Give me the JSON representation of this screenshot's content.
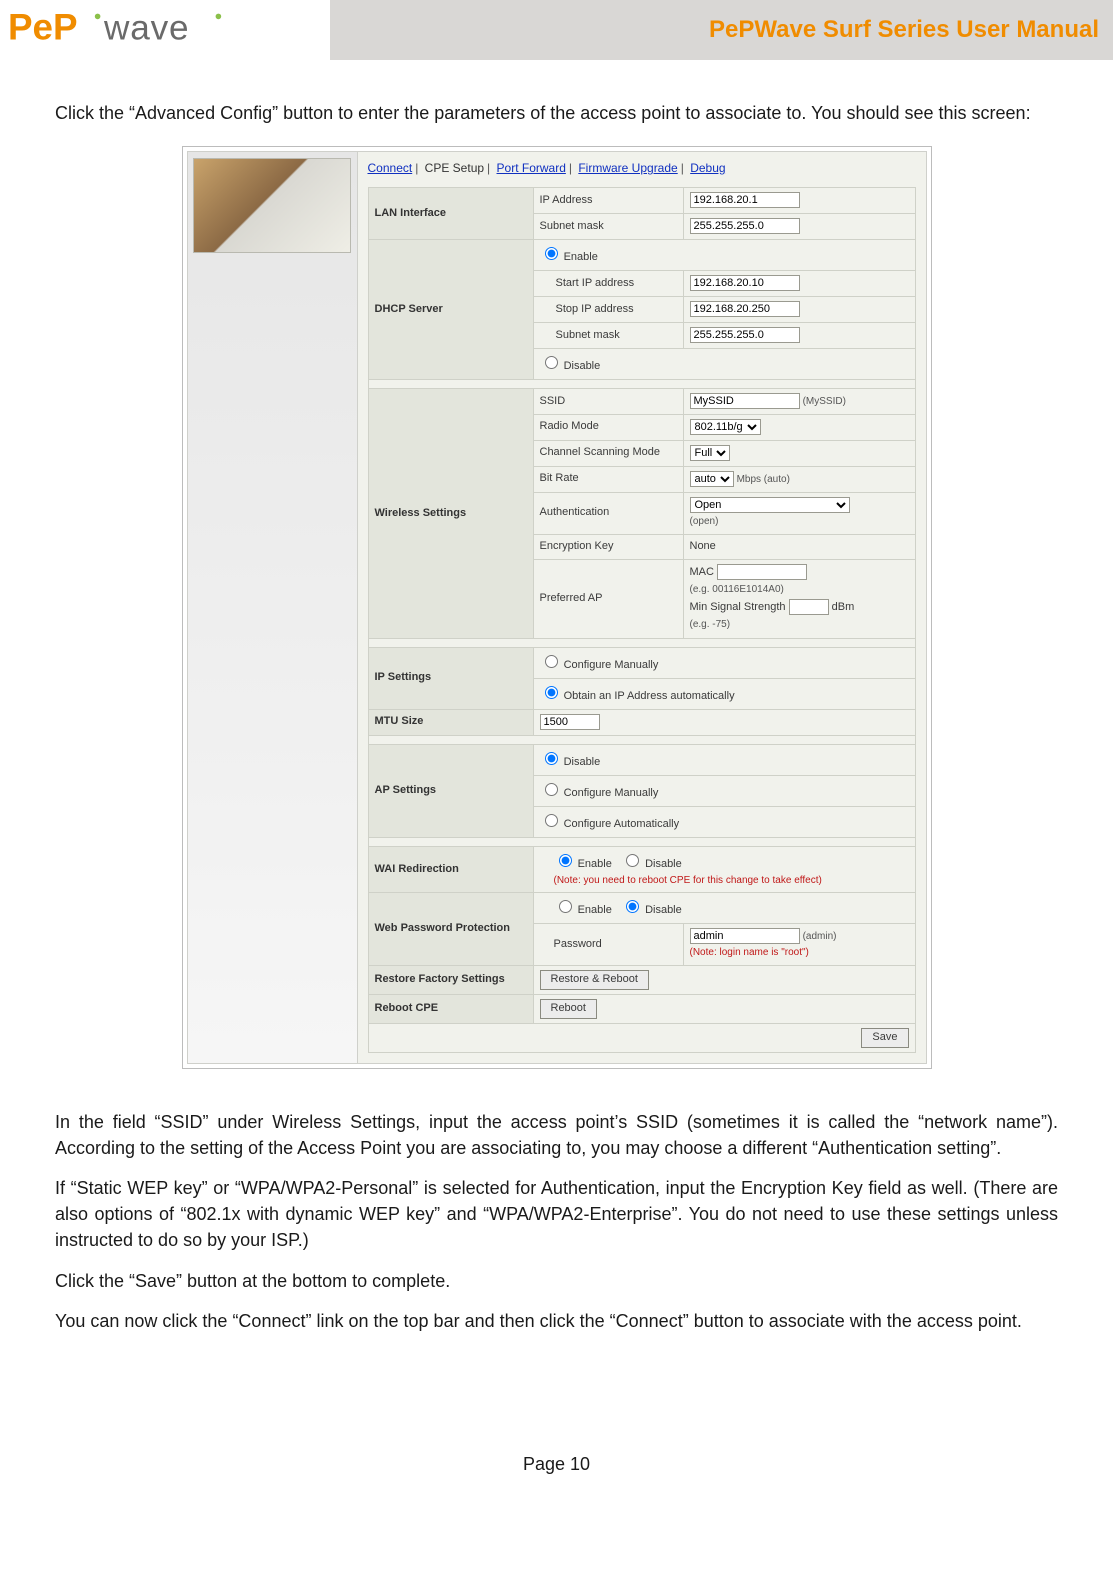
{
  "header": {
    "brand_alt": "PePWave logo",
    "title": "PePWave Surf Series User Manual"
  },
  "intro": "Click the “Advanced Config” button to enter the parameters of the access point to associate to.  You should see this screen:",
  "nav": {
    "connect": "Connect",
    "cpe": "CPE Setup",
    "portfwd": "Port Forward",
    "fw": "Firmware Upgrade",
    "debug": "Debug"
  },
  "sections": {
    "lan": {
      "title": "LAN Interface",
      "ip_label": "IP Address",
      "ip_value": "192.168.20.1",
      "mask_label": "Subnet mask",
      "mask_value": "255.255.255.0"
    },
    "dhcp": {
      "title": "DHCP Server",
      "enable": "Enable",
      "start_label": "Start IP address",
      "start_value": "192.168.20.10",
      "stop_label": "Stop IP address",
      "stop_value": "192.168.20.250",
      "mask_label": "Subnet mask",
      "mask_value": "255.255.255.0",
      "disable": "Disable"
    },
    "wifi": {
      "title": "Wireless Settings",
      "ssid_label": "SSID",
      "ssid_value": "MySSID",
      "ssid_hint": "(MySSID)",
      "radio_label": "Radio Mode",
      "radio_value": "802.11b/g",
      "scan_label": "Channel Scanning Mode",
      "scan_value": "Full",
      "rate_label": "Bit Rate",
      "rate_value": "auto",
      "rate_hint": "Mbps (auto)",
      "auth_label": "Authentication",
      "auth_value": "Open",
      "auth_hint": "(open)",
      "key_label": "Encryption Key",
      "key_value": "None",
      "pref_label": "Preferred AP",
      "pref_mac": "MAC",
      "pref_eg_mac": "(e.g. 00116E1014A0)",
      "pref_min": "Min Signal Strength",
      "pref_dbm": "dBm",
      "pref_eg_db": "(e.g. -75)"
    },
    "ip": {
      "title": "IP Settings",
      "manual": "Configure Manually",
      "auto": "Obtain an IP Address automatically"
    },
    "mtu": {
      "title": "MTU Size",
      "value": "1500"
    },
    "ap": {
      "title": "AP Settings",
      "disable": "Disable",
      "manual": "Configure Manually",
      "auto": "Configure Automatically"
    },
    "wai": {
      "title": "WAI Redirection",
      "enable": "Enable",
      "disable": "Disable",
      "note": "(Note: you need to reboot CPE for this change to take effect)"
    },
    "webpw": {
      "title": "Web Password Protection",
      "enable": "Enable",
      "disable": "Disable",
      "pw_label": "Password",
      "pw_value": "admin",
      "pw_hint": "(admin)",
      "note": "(Note: login name is \"root\")"
    },
    "restore": {
      "title": "Restore Factory Settings",
      "btn": "Restore & Reboot"
    },
    "reboot": {
      "title": "Reboot CPE",
      "btn": "Reboot"
    },
    "save_btn": "Save"
  },
  "para1": "In the field “SSID” under Wireless Settings, input the access point’s SSID (sometimes it is called the “network name”).  According to the setting of the Access Point you are associating to, you may choose a different “Authentication setting”.",
  "para2": "If “Static WEP key” or “WPA/WPA2-Personal” is selected for Authentication, input the Encryption Key field as well. (There are also options of “802.1x with dynamic WEP key” and “WPA/WPA2-Enterprise”.  You do not need to use these settings unless instructed to do so by your ISP.)",
  "para3": "Click the “Save” button at the bottom to complete.",
  "para4": "You can now click the “Connect” link on the top bar and then click the “Connect” button to associate with the access point.",
  "footer": "Page 10"
}
